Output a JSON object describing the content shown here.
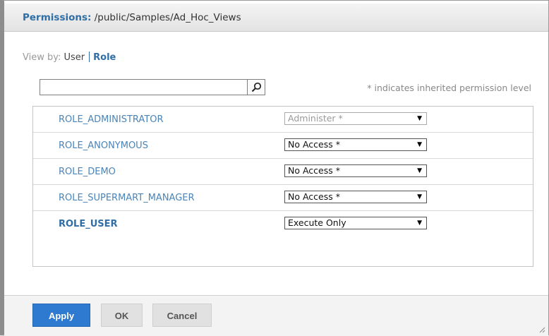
{
  "titlebar": {
    "label": "Permissions:",
    "path": " /public/Samples/Ad_Hoc_Views"
  },
  "view_by": {
    "label": "View by:",
    "user": "User",
    "role": "Role"
  },
  "search": {
    "value": "",
    "placeholder": ""
  },
  "hint": "* indicates inherited permission level",
  "rows": [
    {
      "role": "ROLE_ADMINISTRATOR",
      "permission": "Administer *",
      "disabled": true
    },
    {
      "role": "ROLE_ANONYMOUS",
      "permission": "No Access *",
      "disabled": false
    },
    {
      "role": "ROLE_DEMO",
      "permission": "No Access *",
      "disabled": false
    },
    {
      "role": "ROLE_SUPERMART_MANAGER",
      "permission": "No Access *",
      "disabled": false
    },
    {
      "role": "ROLE_USER",
      "permission": "Execute Only",
      "disabled": false
    }
  ],
  "footer": {
    "apply": "Apply",
    "ok": "OK",
    "cancel": "Cancel"
  },
  "colors": {
    "accent": "#2f6ea6",
    "primary_button": "#2f7ad1"
  }
}
